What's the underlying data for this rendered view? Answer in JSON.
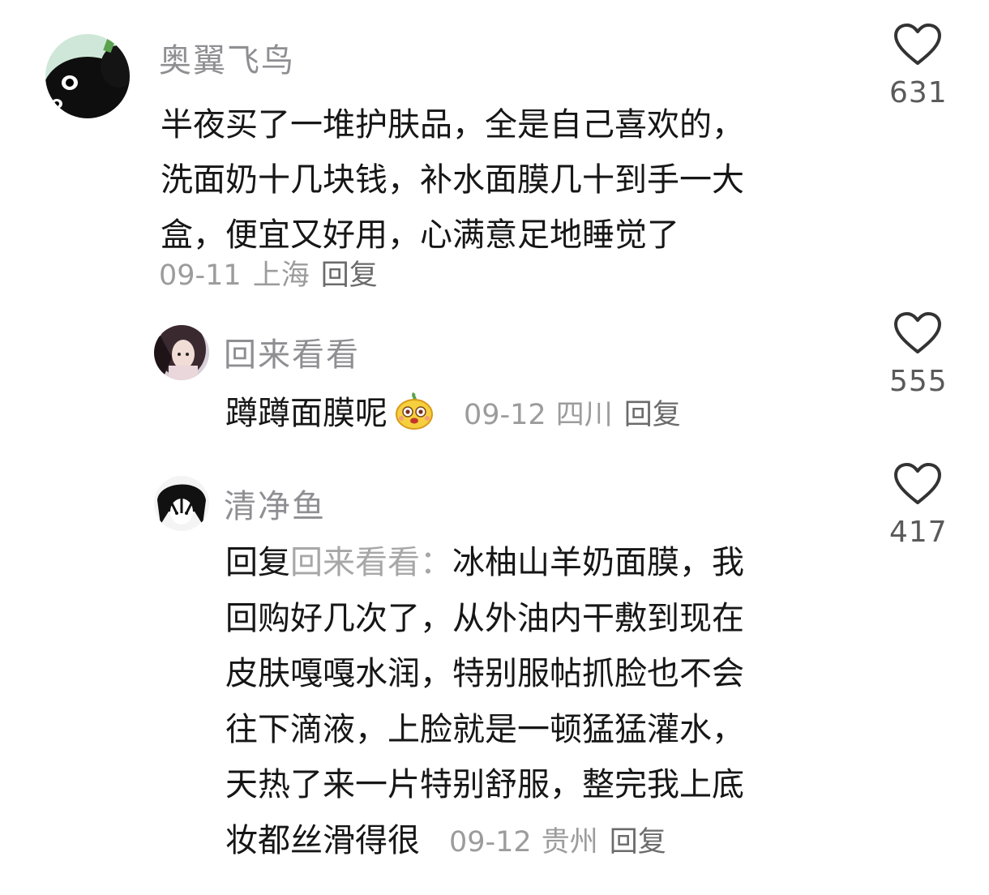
{
  "comments": [
    {
      "username": "奥翼飞鸟",
      "lines": [
        "半夜买了一堆护肤品，全是自己喜欢的，",
        "洗面奶十几块钱，补水面膜几十到手一大",
        "盒，便宜又好用，心满意足地睡觉了"
      ],
      "date": "09-11",
      "location": "上海",
      "reply_label": "回复",
      "likes": "631"
    },
    {
      "username": "回来看看",
      "text": "蹲蹲面膜呢",
      "emoji": "yellow-face-emoji",
      "date": "09-12",
      "location": "四川",
      "reply_label": "回复",
      "likes": "555"
    },
    {
      "username": "清净鱼",
      "reply_prefix": "回复",
      "reply_to": "回来看看：",
      "lines": [
        "冰柚山羊奶面膜，我",
        "回购好几次了，从外油内干敷到现在",
        "皮肤嘎嘎水润，特别服帖抓脸也不会",
        "往下滴液，上脸就是一顿猛猛灌水，",
        "天热了来一片特别舒服，整完我上底",
        "妆都丝滑得很"
      ],
      "date": "09-12",
      "location": "贵州",
      "reply_label": "回复",
      "likes": "417"
    }
  ],
  "colors": {
    "username": "#8f8f93",
    "text": "#161616",
    "meta": "#9c9c9c",
    "heart": "#333333"
  }
}
